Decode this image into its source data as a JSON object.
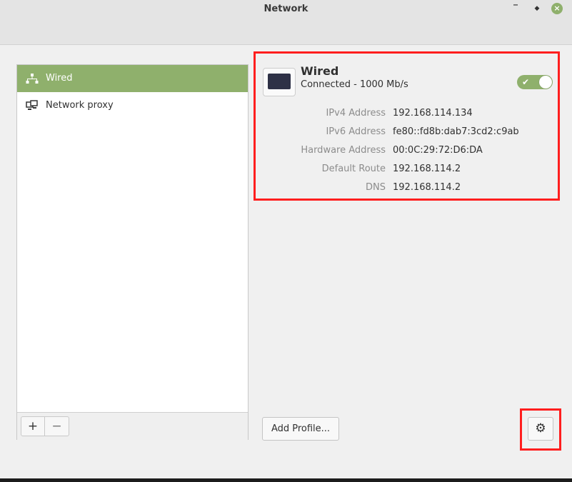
{
  "window": {
    "title": "Network"
  },
  "sidebar": {
    "items": [
      {
        "label": "Wired",
        "icon": "wired-network-icon",
        "selected": true
      },
      {
        "label": "Network proxy",
        "icon": "network-proxy-icon",
        "selected": false
      }
    ],
    "add_label": "+",
    "remove_label": "−"
  },
  "device": {
    "name": "Wired",
    "status": "Connected - 1000 Mb/s",
    "enabled": true,
    "details": [
      {
        "label": "IPv4 Address",
        "value": "192.168.114.134"
      },
      {
        "label": "IPv6 Address",
        "value": "fe80::fd8b:dab7:3cd2:c9ab"
      },
      {
        "label": "Hardware Address",
        "value": "00:0C:29:72:D6:DA"
      },
      {
        "label": "Default Route",
        "value": "192.168.114.2"
      },
      {
        "label": "DNS",
        "value": "192.168.114.2"
      }
    ]
  },
  "actions": {
    "add_profile_label": "Add Profile...",
    "settings_icon": "gear-icon"
  },
  "colors": {
    "accent": "#8fb06c",
    "highlight": "#ff1e1e"
  }
}
